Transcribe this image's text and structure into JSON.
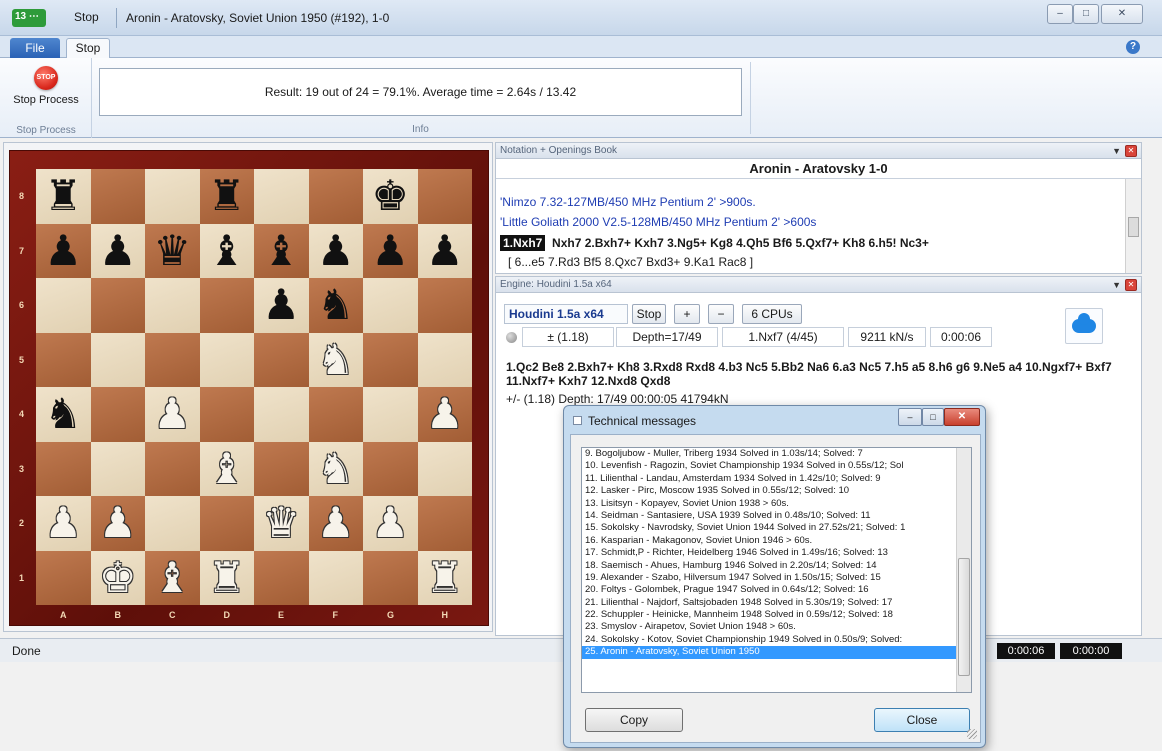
{
  "titlebar": {
    "app_badge": "13",
    "quick_access": "Stop",
    "window_title": "Aronin - Aratovsky, Soviet Union 1950  (#192), 1-0",
    "min_icon": "–",
    "max_icon": "□",
    "close_icon": "✕"
  },
  "ribbon": {
    "tabs": [
      "File",
      "Stop"
    ],
    "help_icon": "?",
    "stop_icon_text": "STOP",
    "stop_label": "Stop Process",
    "stop_group_caption": "Stop Process",
    "info_text": "Result: 19 out of 24 = 79.1%. Average time = 2.64s / 13.42",
    "info_group_caption": "Info"
  },
  "board": {
    "files": [
      "A",
      "B",
      "C",
      "D",
      "E",
      "F",
      "G",
      "H"
    ],
    "ranks": [
      "8",
      "7",
      "6",
      "5",
      "4",
      "3",
      "2",
      "1"
    ],
    "position": [
      [
        "bR",
        "",
        "",
        "bR",
        "",
        "",
        "bK",
        ""
      ],
      [
        "bP",
        "bP",
        "bQ",
        "bB",
        "bB",
        "bP",
        "bP",
        "bP"
      ],
      [
        "",
        "",
        "",
        "",
        "bP",
        "bN",
        "",
        ""
      ],
      [
        "",
        "",
        "",
        "",
        "",
        "wN",
        "",
        ""
      ],
      [
        "bN",
        "",
        "wP",
        "",
        "",
        "",
        "",
        "wP"
      ],
      [
        "",
        "",
        "",
        "wB",
        "",
        "wN",
        "",
        ""
      ],
      [
        "wP",
        "wP",
        "",
        "",
        "wQ",
        "wP",
        "wP",
        ""
      ],
      [
        "",
        "wK",
        "wB",
        "wR",
        "",
        "",
        "",
        "wR"
      ]
    ]
  },
  "notation": {
    "header": "Notation + Openings Book",
    "game_title": "Aronin - Aratovsky  1-0",
    "comment1": "'Nimzo 7.32-127MB/450 MHz Pentium 2'  >900s.",
    "comment2": "'Little Goliath 2000 V2.5-128MB/450 MHz Pentium 2'  >600s",
    "current_move": "1.Nxh7",
    "moves": "Nxh7  2.Bxh7+  Kxh7  3.Ng5+  Kg8  4.Qh5  Bf6  5.Qxf7+  Kh8  6.h5!  Nc3+",
    "variation": "[ 6...e5  7.Rd3  Bf5  8.Qxc7  Bxd3+  9.Ka1  Rac8 ]"
  },
  "engine": {
    "header": "Engine: Houdini 1.5a x64",
    "name": "Houdini 1.5a x64",
    "stop_label": "Stop",
    "add_label": "+",
    "remove_label": "−",
    "cpus_label": "6 CPUs",
    "evaluation": "±  (1.18)",
    "depth": "Depth=17/49",
    "current_move": "1.Nxf7 (4/45)",
    "speed": "9211 kN/s",
    "time": "0:00:06",
    "pv_line": "1.Qc2 Be8 2.Bxh7+ Kh8 3.Rxd8 Rxd8 4.b3 Nc5 5.Bb2 Na6 6.a3 Nc5 7.h5 a5 8.h6 g6 9.Ne5 a4 10.Ngxf7+ Bxf7 11.Nxf7+ Kxh7 12.Nxd8 Qxd8",
    "pv_info": "+/-  (1.18)   Depth: 17/49   00:00:05  41794kN"
  },
  "status": {
    "text": "Done",
    "clock1": "0:00:06",
    "clock2": "0:00:00"
  },
  "dialog": {
    "title": "Technical messages",
    "messages": [
      "9. Bogoljubow - Muller,  Triberg 1934  Solved in 1.03s/14; Solved: 7",
      "10. Levenfish - Ragozin,  Soviet Championship 1934  Solved in 0.55s/12; Sol",
      "11. Lilienthal - Landau,  Amsterdam 1934  Solved in 1.42s/10; Solved: 9",
      "12. Lasker - Pirc,  Moscow 1935  Solved in 0.55s/12; Solved: 10",
      "13. Lisitsyn - Kopayev,  Soviet Union 1938  > 60s.",
      "14. Seidman - Santasiere,  USA 1939  Solved in 0.48s/10; Solved: 11",
      "15. Sokolsky - Navrodsky,  Soviet Union 1944  Solved in 27.52s/21; Solved: 1",
      "16. Kasparian - Makagonov,  Soviet Union 1946  > 60s.",
      "17. Schmidt,P - Richter,  Heidelberg 1946  Solved in 1.49s/16; Solved: 13",
      "18. Saemisch - Ahues,  Hamburg 1946  Solved in 2.20s/14; Solved: 14",
      "19. Alexander - Szabo,  Hilversum 1947  Solved in 1.50s/15; Solved: 15",
      "20. Foltys - Golombek,  Prague 1947  Solved in 0.64s/12; Solved: 16",
      "21. Lilienthal - Najdorf,  Saltsjobaden 1948  Solved in 5.30s/19; Solved: 17",
      "22. Schuppler - Heinicke,  Mannheim 1948  Solved in 0.59s/12; Solved: 18",
      "23. Smyslov - Airapetov,  Soviet Union 1948  > 60s.",
      "24. Sokolsky - Kotov,  Soviet Championship 1949  Solved in 0.50s/9; Solved:",
      "25. Aronin - Aratovsky,  Soviet Union 1950"
    ],
    "selected_index": 16,
    "copy_label": "Copy",
    "close_label": "Close"
  }
}
